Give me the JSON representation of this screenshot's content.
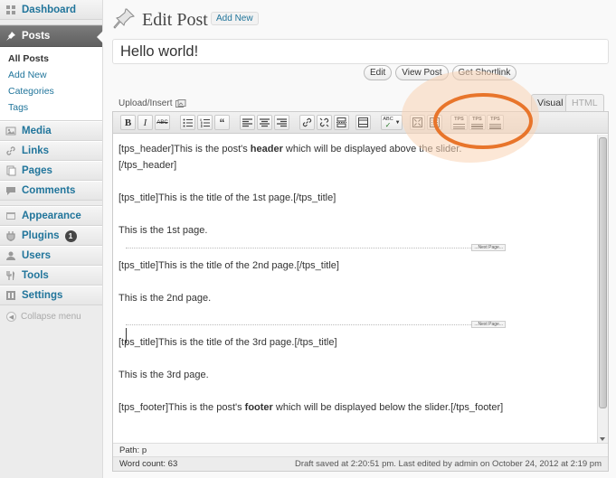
{
  "sidebar": {
    "dashboard": "Dashboard",
    "posts": "Posts",
    "posts_sub": [
      "All Posts",
      "Add New",
      "Categories",
      "Tags"
    ],
    "media": "Media",
    "links": "Links",
    "pages": "Pages",
    "comments": "Comments",
    "appearance": "Appearance",
    "plugins": "Plugins",
    "plugins_badge": "1",
    "users": "Users",
    "tools": "Tools",
    "settings": "Settings",
    "collapse": "Collapse menu"
  },
  "header": {
    "title": "Edit Post",
    "add_new": "Add New"
  },
  "post": {
    "title_value": "Hello world!"
  },
  "shortlink_buttons": [
    "Edit",
    "View Post",
    "Get Shortlink"
  ],
  "editor": {
    "upload_insert": "Upload/Insert",
    "tab_visual": "Visual",
    "tab_html": "HTML",
    "toolbar_icons": [
      "bold-icon",
      "italic-icon",
      "strikethrough-icon",
      "bullet-list-icon",
      "numbered-list-icon",
      "blockquote-icon",
      "align-left-icon",
      "align-center-icon",
      "align-right-icon",
      "link-icon",
      "unlink-icon",
      "more-tag-icon",
      "toggle-toolbar-icon",
      "spellcheck-icon",
      "fullscreen-icon",
      "kitchen-sink-icon",
      "tps-header-icon",
      "tps-title-icon",
      "tps-footer-icon"
    ],
    "tps_label": "TPS",
    "content": {
      "p1_before": "[tps_header]This is the post's ",
      "p1_bold": "header",
      "p1_after": " which will be displayed above the slider.",
      "p1_line2": "[/tps_header]",
      "p2": "[tps_title]This is the title of the 1st page.[/tps_title]",
      "p3": "This is the 1st page.",
      "next_page": "...Next Page...",
      "p4": "[tps_title]This is the title of the 2nd page.[/tps_title]",
      "p5": "This is the 2nd page.",
      "p6": "[tps_title]This is the title of the 3rd page.[/tps_title]",
      "p7": "This is the 3rd page.",
      "p8_before": "[tps_footer]This is the post's ",
      "p8_bold": "footer",
      "p8_after": " which will be displayed below the slider.[/tps_footer]"
    },
    "path_label": "Path:",
    "path_value": "p",
    "word_count": "Word count: 63",
    "draft_status": "Draft saved at 2:20:51 pm. Last edited by admin on October 24, 2012 at 2:19 pm"
  },
  "colors": {
    "link": "#21759b",
    "highlight_ring": "#e8752b",
    "highlight_glow": "#f9d3b5"
  }
}
